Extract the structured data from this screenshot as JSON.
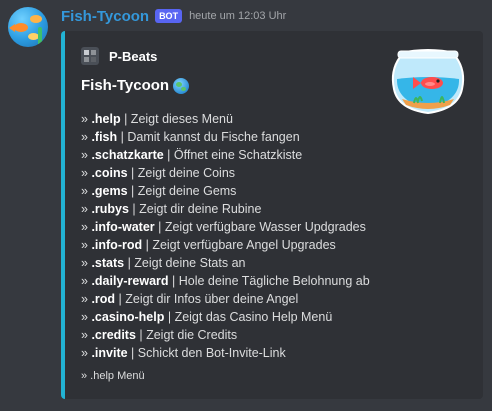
{
  "message": {
    "username": "Fish-Tycoon",
    "bot_tag": "BOT",
    "timestamp": "heute um 12:03 Uhr"
  },
  "embed": {
    "accent_color": "#22b3d4",
    "author": {
      "name": "P-Beats",
      "icon": "cube-icon"
    },
    "title": "Fish-Tycoon",
    "title_icon": "globe-icon",
    "thumbnail_icon": "fishbowl-icon",
    "commands": [
      {
        "prefix": "» ",
        "name": ".help",
        "desc": " | Zeigt dieses Menü"
      },
      {
        "prefix": "» ",
        "name": ".fish",
        "desc": " | Damit kannst du Fische fangen"
      },
      {
        "prefix": "» ",
        "name": ".schatzkarte",
        "desc": " | Öffnet eine Schatzkiste"
      },
      {
        "prefix": "» ",
        "name": ".coins",
        "desc": " | Zeigt deine Coins"
      },
      {
        "prefix": "» ",
        "name": ".gems",
        "desc": " | Zeigt deine Gems"
      },
      {
        "prefix": "» ",
        "name": ".rubys",
        "desc": " | Zeigt dir deine Rubine"
      },
      {
        "prefix": "» ",
        "name": ".info-water",
        "desc": " | Zeigt verfügbare Wasser Updgrades"
      },
      {
        "prefix": "» ",
        "name": ".info-rod",
        "desc": " | Zeigt verfügbare Angel Upgrades"
      },
      {
        "prefix": "» ",
        "name": ".stats",
        "desc": " | Zeigt deine Stats an"
      },
      {
        "prefix": "» ",
        "name": ".daily-reward",
        "desc": " | Hole deine Tägliche Belohnung ab"
      },
      {
        "prefix": "» ",
        "name": ".rod",
        "desc": " | Zeigt dir Infos über deine Angel"
      },
      {
        "prefix": "» ",
        "name": ".casino-help",
        "desc": " | Zeigt das Casino Help Menü"
      },
      {
        "prefix": "» ",
        "name": ".credits",
        "desc": " | Zeigt die Credits"
      },
      {
        "prefix": "» ",
        "name": ".invite",
        "desc": " | Schickt den Bot-Invite-Link"
      }
    ],
    "footer": "» .help Menü"
  }
}
